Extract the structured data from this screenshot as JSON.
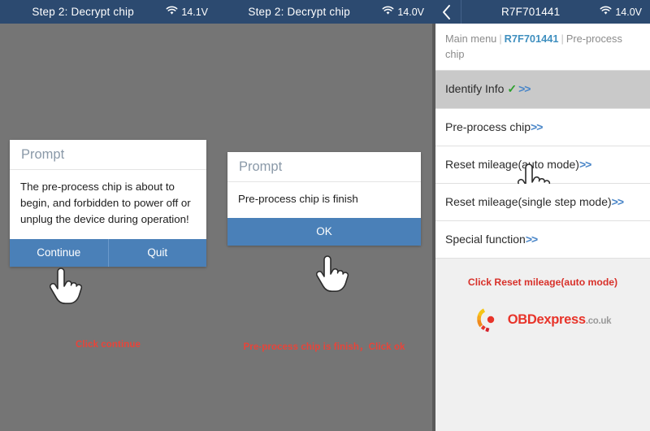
{
  "colors": {
    "statusbar_bg": "#2c4a70",
    "button_blue": "#4a80b8",
    "workspace_gray": "#757575",
    "panel_gray": "#f0f0f0",
    "caption_red": "#e8443a",
    "accent_blue": "#4a86c8",
    "check_green": "#2ca02c",
    "crumb_active": "#3f8fbf",
    "brand_red": "#e8342a",
    "brand_orange": "#f5a623"
  },
  "panels": [
    {
      "statusbar": {
        "title": "Step 2: Decrypt chip",
        "voltage": "14.1V",
        "wifi_icon": "wifi-icon"
      },
      "dialog": {
        "title": "Prompt",
        "message": "The pre-process chip is about to begin, and forbidden to power off or unplug the device during operation!",
        "buttons": [
          {
            "label": "Continue",
            "name": "continue-button"
          },
          {
            "label": "Quit",
            "name": "quit-button"
          }
        ]
      },
      "caption": "Click continue"
    },
    {
      "statusbar": {
        "title": "Step 2: Decrypt chip",
        "voltage": "14.0V",
        "wifi_icon": "wifi-icon"
      },
      "dialog": {
        "title": "Prompt",
        "message": "Pre-process chip is finish",
        "buttons": [
          {
            "label": "OK",
            "name": "ok-button"
          }
        ]
      },
      "caption": "Pre-process chip is finish，Click ok"
    }
  ],
  "right_panel": {
    "statusbar": {
      "back_icon": "chevron-left-icon",
      "title": "R7F701441",
      "voltage": "14.0V",
      "wifi_icon": "wifi-icon"
    },
    "breadcrumb": {
      "root": "Main menu",
      "sep": "|",
      "active": "R7F701441",
      "current": "Pre-process chip"
    },
    "menu_items": [
      {
        "label": "Identify Info",
        "check": "✓",
        "chevron": ">>",
        "selected": true,
        "name": "menu-item-identify-info"
      },
      {
        "label": "Pre-process chip",
        "check": "",
        "chevron": ">>",
        "selected": false,
        "name": "menu-item-pre-process-chip"
      },
      {
        "label": "Reset mileage(auto mode)",
        "check": "",
        "chevron": ">>",
        "selected": false,
        "name": "menu-item-reset-mileage-auto"
      },
      {
        "label": "Reset mileage(single step mode)",
        "check": "",
        "chevron": ">>",
        "selected": false,
        "name": "menu-item-reset-mileage-single-step"
      },
      {
        "label": "Special function",
        "check": "",
        "chevron": ">>",
        "selected": false,
        "name": "menu-item-special-function"
      }
    ],
    "note": "Click Reset mileage(auto mode)",
    "logo": {
      "part_o": "OBD",
      "part_express": "express",
      "tld": ".co.uk",
      "mark": "obdexpress-logo-icon"
    }
  }
}
